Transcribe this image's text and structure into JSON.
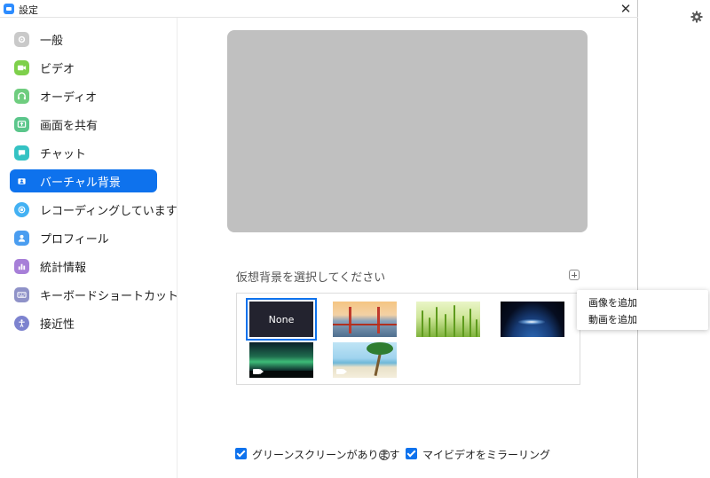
{
  "window": {
    "title": "設定"
  },
  "sidebar": {
    "items": [
      {
        "label": "一般",
        "icon": "gear-icon",
        "color": "#c9c9c9"
      },
      {
        "label": "ビデオ",
        "icon": "video-camera-icon",
        "color": "#7ed04b"
      },
      {
        "label": "オーディオ",
        "icon": "headphones-icon",
        "color": "#6fcd7f"
      },
      {
        "label": "画面を共有",
        "icon": "share-screen-icon",
        "color": "#5bc68b"
      },
      {
        "label": "チャット",
        "icon": "chat-bubble-icon",
        "color": "#34c2c3"
      },
      {
        "label": "バーチャル背景",
        "icon": "virtual-background-icon",
        "color": "#0e72ed",
        "active": true
      },
      {
        "label": "レコーディングしています",
        "icon": "record-icon",
        "color": "#43b1f3"
      },
      {
        "label": "プロフィール",
        "icon": "profile-icon",
        "color": "#4a9df0"
      },
      {
        "label": "統計情報",
        "icon": "statistics-icon",
        "color": "#a77fd8"
      },
      {
        "label": "キーボードショートカット",
        "icon": "keyboard-icon",
        "color": "#8f92c8"
      },
      {
        "label": "接近性",
        "icon": "accessibility-icon",
        "color": "#7d83cf"
      }
    ]
  },
  "main": {
    "choose_label": "仮想背景を選択してください",
    "backgrounds": [
      {
        "label": "None",
        "selected": true
      },
      {
        "label": "golden-gate-bridge",
        "video": false
      },
      {
        "label": "grass",
        "video": false
      },
      {
        "label": "earth-from-space",
        "video": false
      },
      {
        "label": "aurora",
        "video": true
      },
      {
        "label": "beach",
        "video": true
      }
    ],
    "options": {
      "green_screen": {
        "label": "グリーンスクリーンがあります",
        "checked": true
      },
      "mirror_video": {
        "label": "マイビデオをミラーリング",
        "checked": true
      }
    }
  },
  "add_menu": {
    "items": [
      "画像を追加",
      "動画を追加"
    ]
  },
  "colors": {
    "accent": "#0e72ed",
    "preview_bg": "#c0c0c0"
  }
}
